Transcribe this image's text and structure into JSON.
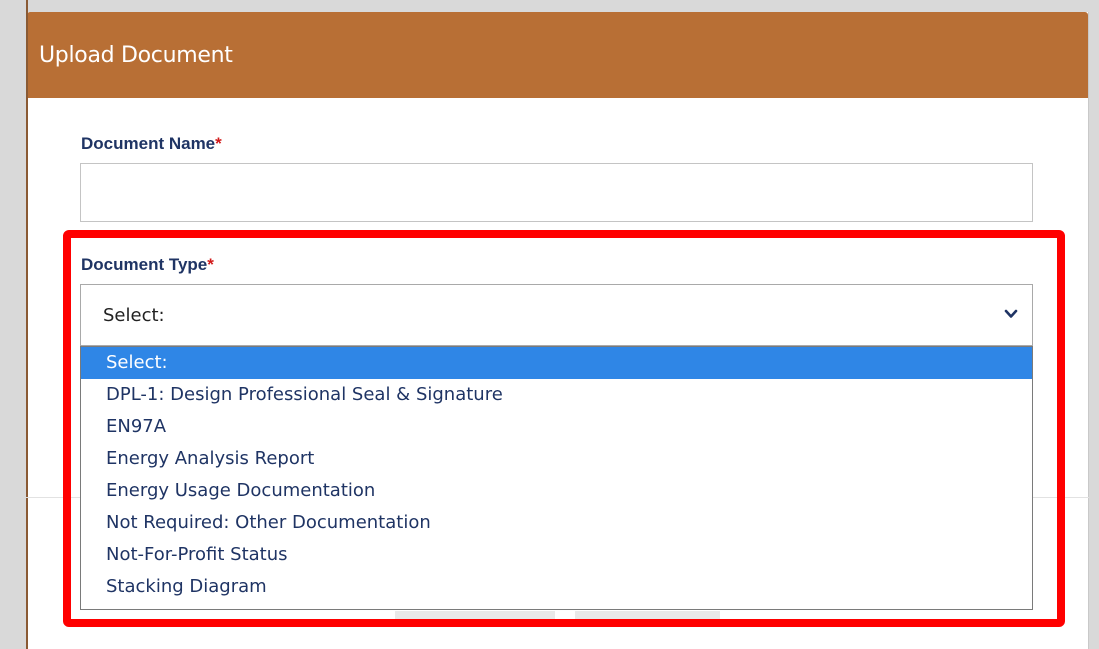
{
  "dialog": {
    "title": "Upload Document",
    "document_name": {
      "label": "Document Name",
      "required_marker": "*",
      "value": ""
    },
    "document_type": {
      "label": "Document Type",
      "required_marker": "*",
      "selected": "Select:",
      "chevron_icon": "chevron-down-icon",
      "options": [
        "Select:",
        "DPL-1: Design Professional Seal & Signature",
        "EN97A",
        "Energy Analysis Report",
        "Energy Usage Documentation",
        "Not Required: Other Documentation",
        "Not-For-Profit Status",
        "Stacking Diagram"
      ],
      "highlighted_index": 0
    }
  },
  "colors": {
    "header": "#b86f35",
    "label_text": "#1f3464",
    "required": "#d11a1a",
    "selected_option_bg": "#2f86e6",
    "annotation_box": "#ff0000"
  }
}
